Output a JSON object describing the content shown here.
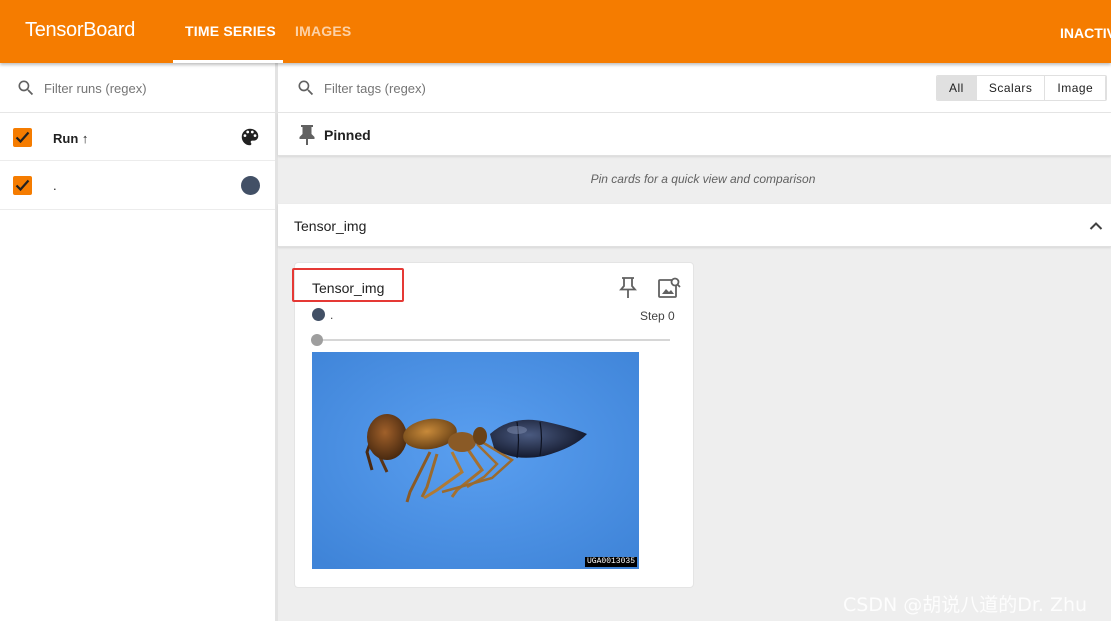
{
  "header": {
    "brand": "TensorBoard",
    "tabs": [
      {
        "label": "TIME SERIES",
        "active": true
      },
      {
        "label": "IMAGES",
        "active": false
      }
    ],
    "status": "INACTIV"
  },
  "runs_panel": {
    "filter_placeholder": "Filter runs (regex)",
    "header_label": "Run ↑",
    "runs": [
      {
        "name": ".",
        "checked": true,
        "color": "#425066"
      }
    ]
  },
  "main": {
    "filter_placeholder": "Filter tags (regex)",
    "type_filters": [
      "All",
      "Scalars",
      "Image"
    ],
    "pinned_label": "Pinned",
    "pinned_hint": "Pin cards for a quick view and comparison",
    "groups": [
      {
        "title": "Tensor_img",
        "cards": [
          {
            "title": "Tensor_img",
            "run_name": ".",
            "step_label": "Step 0",
            "image_tag": "UGA0013035"
          }
        ]
      }
    ]
  },
  "watermark": "CSDN @胡说八道的Dr. Zhu",
  "colors": {
    "accent": "#f57c00",
    "run_color": "#425066",
    "highlight_box": "#e53935"
  }
}
